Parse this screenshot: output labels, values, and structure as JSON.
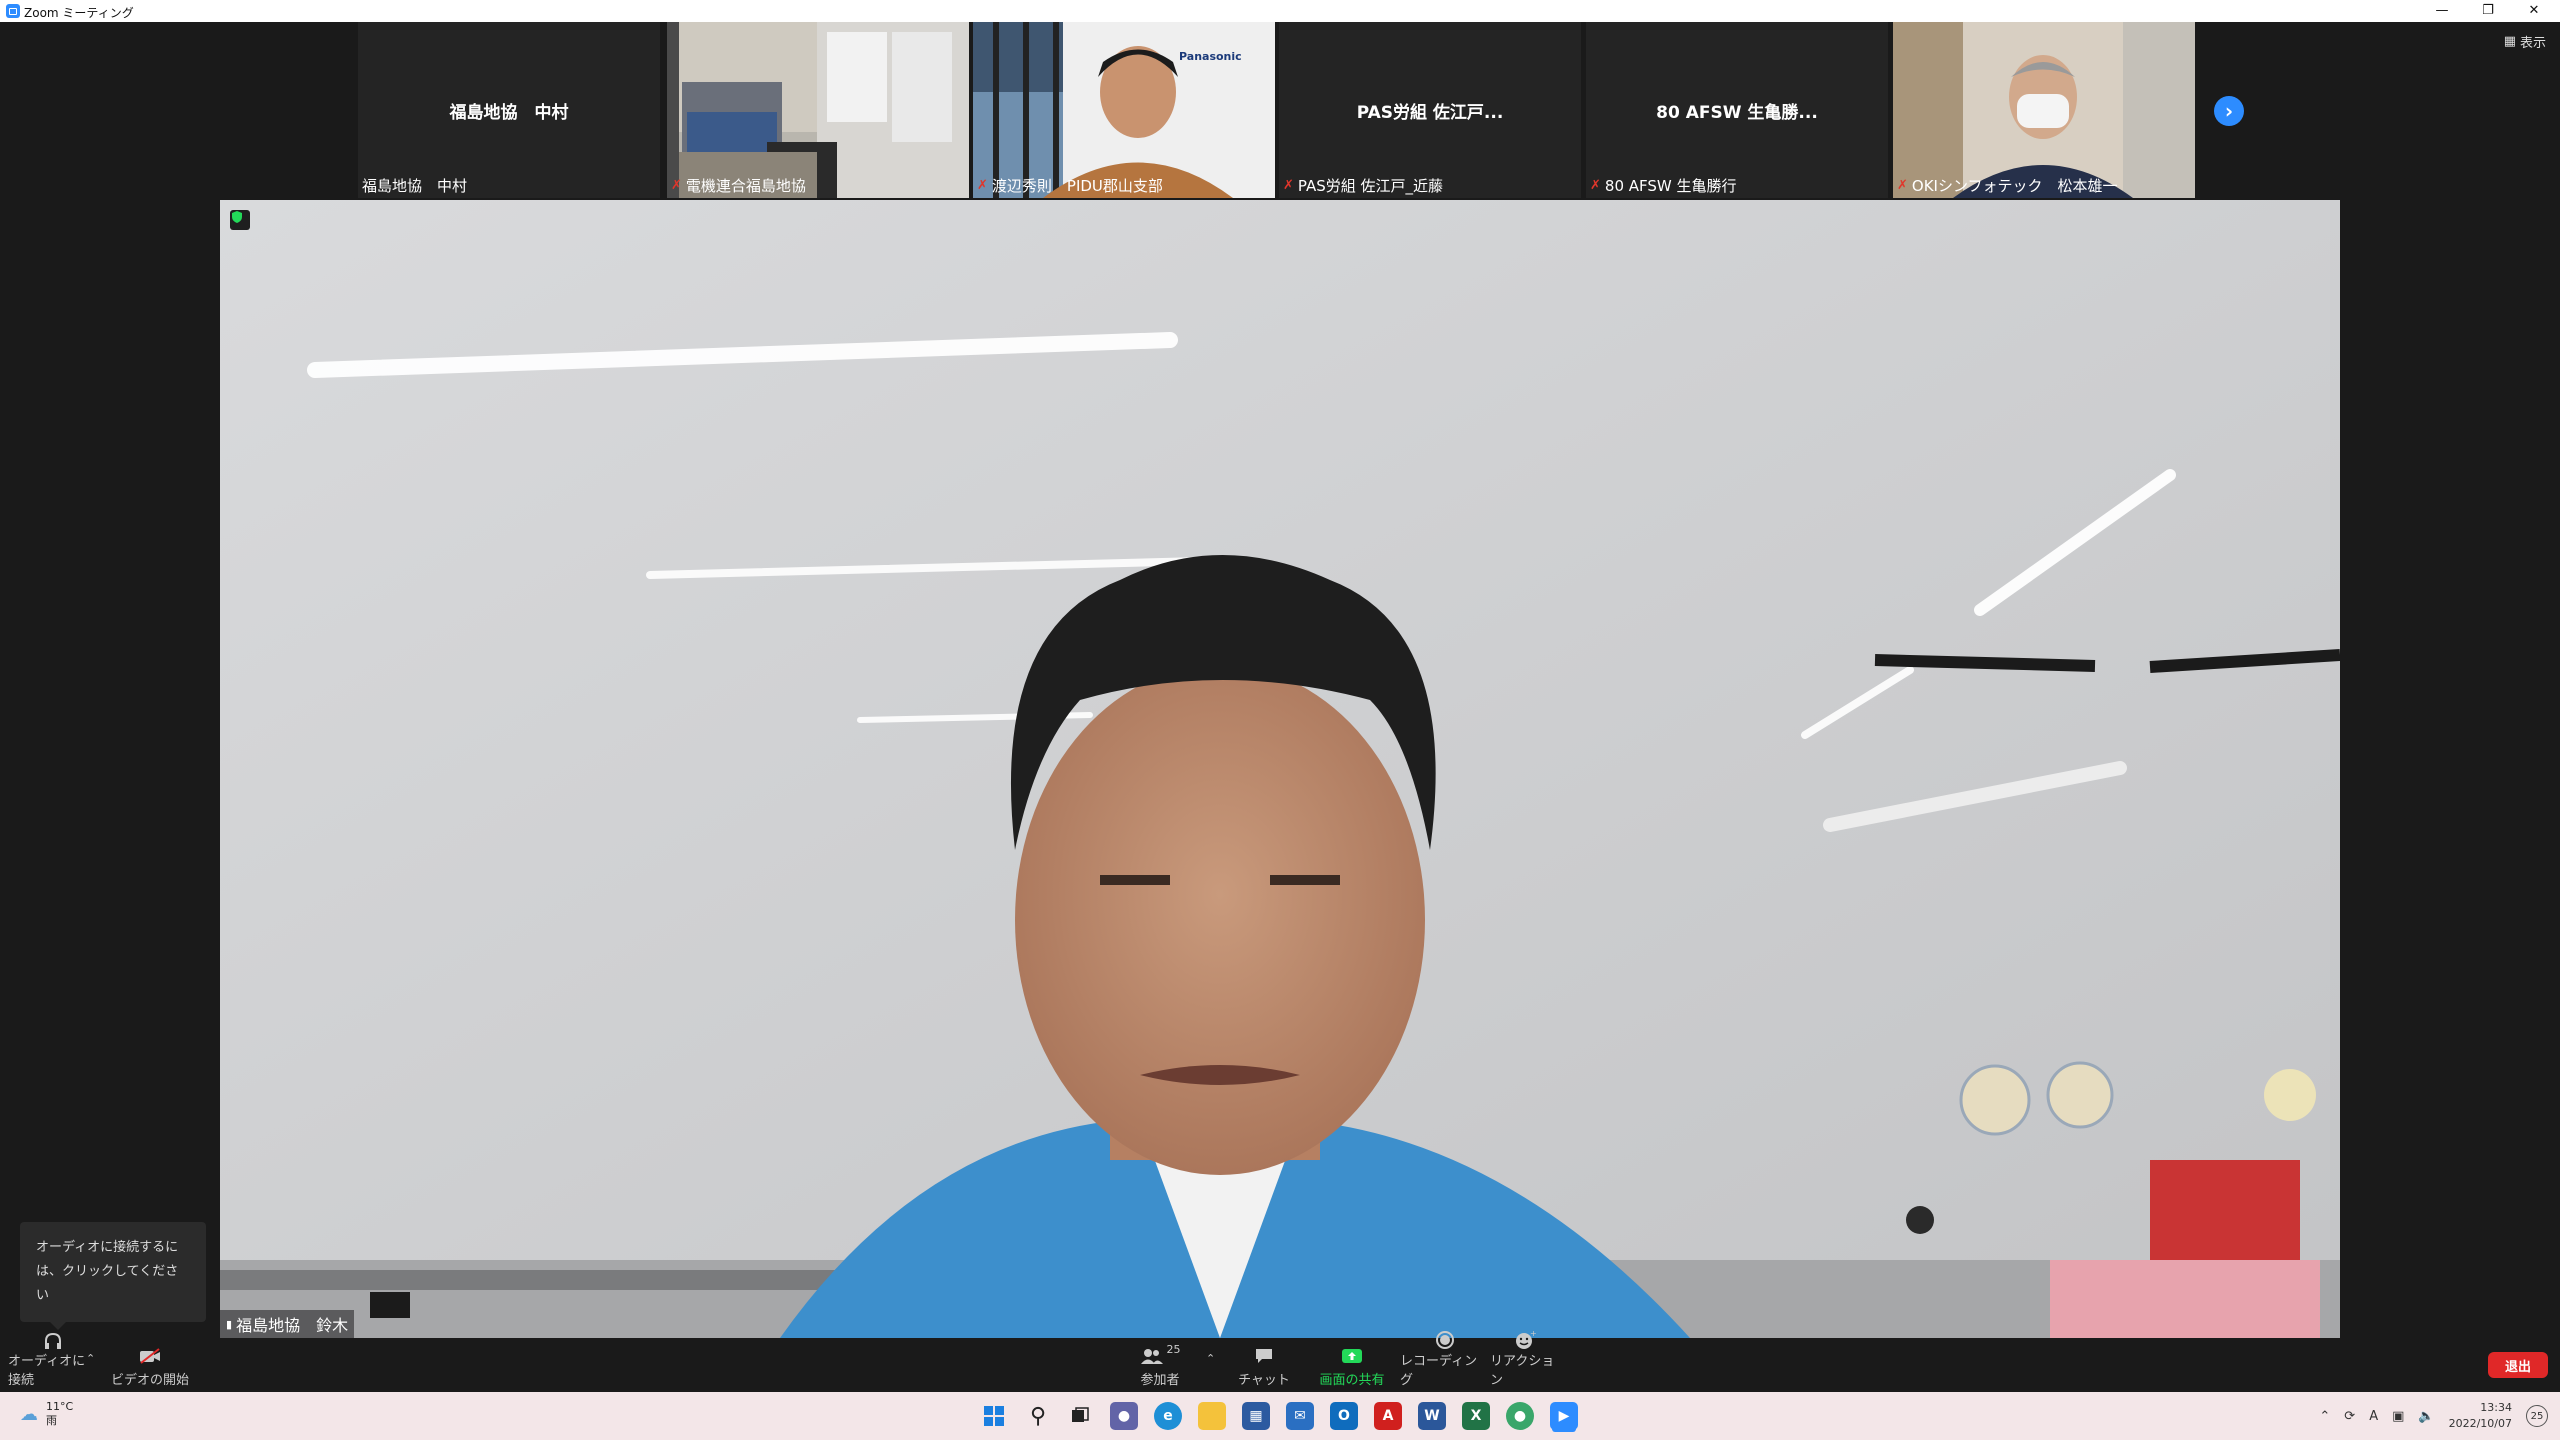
{
  "window": {
    "title": "Zoom ミーティング"
  },
  "top_right": {
    "view_label": "表示"
  },
  "tiles": [
    {
      "display_name": "福島地協　中村",
      "label": "福島地協　中村",
      "video": false,
      "muted": false
    },
    {
      "display_name": "",
      "label": "電機連合福島地協",
      "video": true,
      "muted": true
    },
    {
      "display_name": "",
      "label": "渡辺秀則　PIDU郡山支部",
      "video": true,
      "muted": true,
      "backdrop_text": "Panasonic"
    },
    {
      "display_name": "PAS労組 佐江戸...",
      "label": "PAS労組 佐江戸_近藤",
      "video": false,
      "muted": true
    },
    {
      "display_name": "80 AFSW 生亀勝...",
      "label": "80 AFSW 生亀勝行",
      "video": false,
      "muted": true
    },
    {
      "display_name": "",
      "label": "OKIシンフォテック　松本雄一",
      "video": true,
      "muted": true
    }
  ],
  "main_video": {
    "label": "福島地協　鈴木"
  },
  "audio_tooltip": {
    "text": "オーディオに接続するには、クリックしてください"
  },
  "toolbar": {
    "audio_label": "オーディオに接続",
    "video_label": "ビデオの開始",
    "participants_label": "参加者",
    "participants_count": "25",
    "chat_label": "チャット",
    "share_label": "画面の共有",
    "record_label": "レコーディング",
    "reaction_label": "リアクション",
    "leave_label": "退出"
  },
  "taskbar": {
    "weather_temp": "11°C",
    "weather_cond": "雨",
    "time": "13:34",
    "date": "2022/10/07",
    "ime": "A",
    "notification_count": "25"
  },
  "colors": {
    "accent": "#2D8CFF",
    "share_green": "#23d959",
    "leave_red": "#e02828"
  }
}
